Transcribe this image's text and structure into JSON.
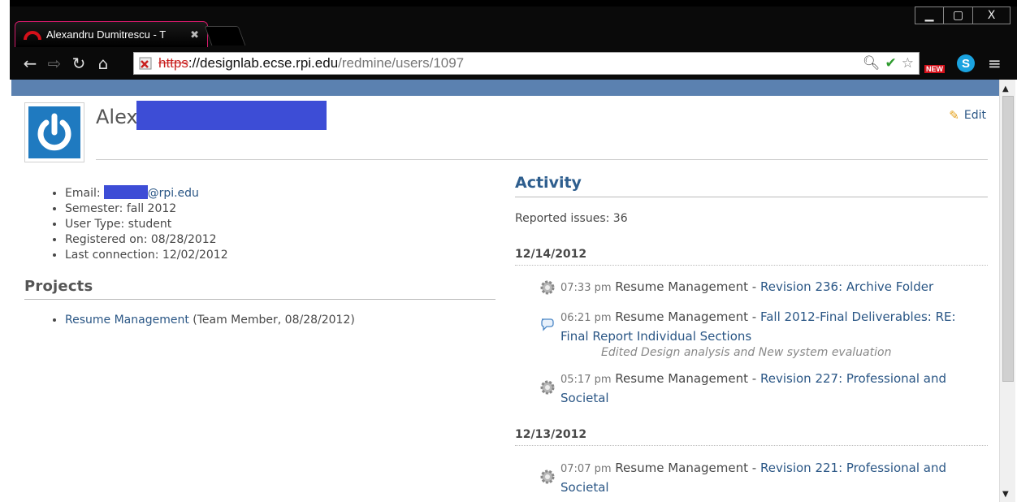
{
  "browser": {
    "tab_title": "Alexandru Dumitrescu - T",
    "tab_close": "✖",
    "url_scheme": "https",
    "url_host": "://designlab.ecse.rpi.edu",
    "url_path": "/redmine/users/1097",
    "new_badge": "NEW",
    "skype_letter": "S",
    "window_buttons": {
      "minimize": "▁",
      "maximize": "▢",
      "close": "X"
    }
  },
  "user": {
    "name_visible": "Alex",
    "edit_label": "Edit",
    "details": {
      "email_label": "Email:",
      "email_domain": "@rpi.edu",
      "semester": "Semester: fall 2012",
      "user_type": "User Type: student",
      "registered": "Registered on: 08/28/2012",
      "last_connection": "Last connection: 12/02/2012"
    }
  },
  "projects": {
    "title": "Projects",
    "items": [
      {
        "name": "Resume Management",
        "role": " (Team Member, 08/28/2012)"
      }
    ]
  },
  "activity": {
    "title": "Activity",
    "reported_issues": "Reported issues: 36",
    "days": [
      {
        "date": "12/14/2012",
        "events": [
          {
            "icon": "gear-icon",
            "time": "07:33 pm",
            "project": "Resume Management -",
            "title": "Revision 236: Archive Folder",
            "desc": ""
          },
          {
            "icon": "comment-icon",
            "time": "06:21 pm",
            "project": "Resume Management -",
            "title": "Fall 2012-Final Deliverables: RE: Final Report Individual Sections",
            "desc": "Edited Design analysis and New system evaluation"
          },
          {
            "icon": "gear-icon",
            "time": "05:17 pm",
            "project": "Resume Management -",
            "title": "Revision 227: Professional and Societal",
            "desc": ""
          }
        ]
      },
      {
        "date": "12/13/2012",
        "events": [
          {
            "icon": "gear-icon",
            "time": "07:07 pm",
            "project": "Resume Management -",
            "title": "Revision 221: Professional and Societal",
            "desc": ""
          }
        ]
      }
    ]
  },
  "colors": {
    "top_bar": "#5b81b0",
    "link": "#2a5685",
    "redaction": "#3d4dd6",
    "avatar_bg": "#1f7ac0"
  }
}
